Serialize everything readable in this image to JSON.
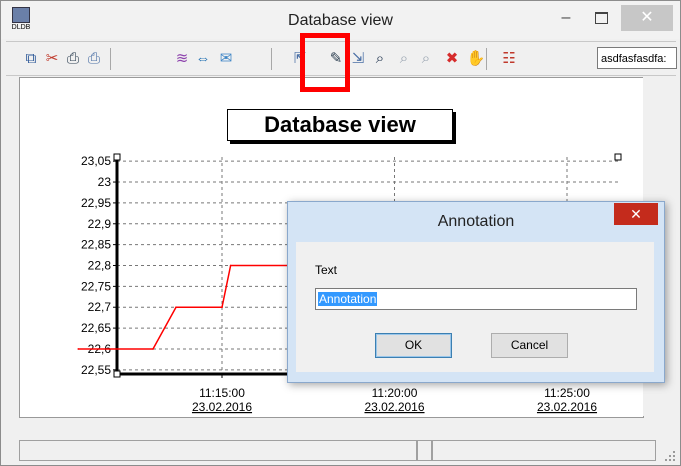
{
  "window": {
    "title": "Database view",
    "app_icon_label": "DLDB",
    "minimize_symbol": "–",
    "close_symbol": "✕"
  },
  "toolbar": {
    "buttons": [
      {
        "name": "copy-icon",
        "glyph": "⧉",
        "color": "#2b5797"
      },
      {
        "name": "cut-chart-icon",
        "glyph": "✂",
        "color": "#c0392b"
      },
      {
        "name": "print-icon",
        "glyph": "⎙",
        "color": "#2c3e50"
      },
      {
        "name": "print-preview-icon",
        "glyph": "⎙",
        "color": "#4a6fa5"
      },
      {
        "name": "series-colors-icon",
        "glyph": "≋",
        "color": "#8e44ad"
      },
      {
        "name": "fit-width-icon",
        "glyph": "⇔",
        "color": "#1f6fb2"
      },
      {
        "name": "value-labels-icon",
        "glyph": "✉",
        "color": "#3d85c6"
      },
      {
        "name": "pointer-icon",
        "glyph": "⇱",
        "color": "#4a6fa5"
      },
      {
        "name": "annotation-icon",
        "glyph": "✎",
        "color": "#2c3e50"
      },
      {
        "name": "export-icon",
        "glyph": "⇲",
        "color": "#4a6fa5"
      },
      {
        "name": "zoom-icon",
        "glyph": "⌕",
        "color": "#1b2f4a"
      },
      {
        "name": "zoom-out-icon",
        "glyph": "⌕",
        "color": "#9aa5b1"
      },
      {
        "name": "zoom-in-icon",
        "glyph": "⌕",
        "color": "#9aa5b1"
      },
      {
        "name": "delete-icon",
        "glyph": "✖",
        "color": "#d62c2c"
      },
      {
        "name": "pan-hand-icon",
        "glyph": "✋",
        "color": "#333333"
      },
      {
        "name": "settings-icon",
        "glyph": "☷",
        "color": "#c0392b"
      }
    ],
    "input_value": "asdfasfasdfa:"
  },
  "chart_data": {
    "type": "line",
    "title": "Database view",
    "xlabel": "",
    "ylabel": "",
    "y_ticks": [
      "23,05",
      "23",
      "22,95",
      "22,9",
      "22,85",
      "22,8",
      "22,75",
      "22,7",
      "22,65",
      "22,6",
      "22,55"
    ],
    "ylim": [
      22.54,
      23.06
    ],
    "x_ticks": [
      {
        "time": "11:15:00",
        "date": "23.02.2016"
      },
      {
        "time": "11:20:00",
        "date": "23.02.2016"
      },
      {
        "time": "11:25:00",
        "date": "23.02.2016"
      }
    ],
    "grid": true,
    "series": [
      {
        "color": "#ff0000",
        "points": [
          {
            "x": "11:10:50",
            "y": 22.6
          },
          {
            "x": "11:13:00",
            "y": 22.6
          },
          {
            "x": "11:13:40",
            "y": 22.7
          },
          {
            "x": "11:15:00",
            "y": 22.7
          },
          {
            "x": "11:15:15",
            "y": 22.8
          },
          {
            "x": "11:17:00",
            "y": 22.8
          },
          {
            "x": "11:17:25",
            "y": 22.7
          }
        ]
      }
    ]
  },
  "dialog": {
    "title": "Annotation",
    "close_symbol": "✕",
    "label": "Text",
    "input_value": "Annotation",
    "ok_label": "OK",
    "cancel_label": "Cancel"
  },
  "colors": {
    "highlight": "#ff0000",
    "series": "#ff0000",
    "dialog_close": "#c42b1c"
  }
}
